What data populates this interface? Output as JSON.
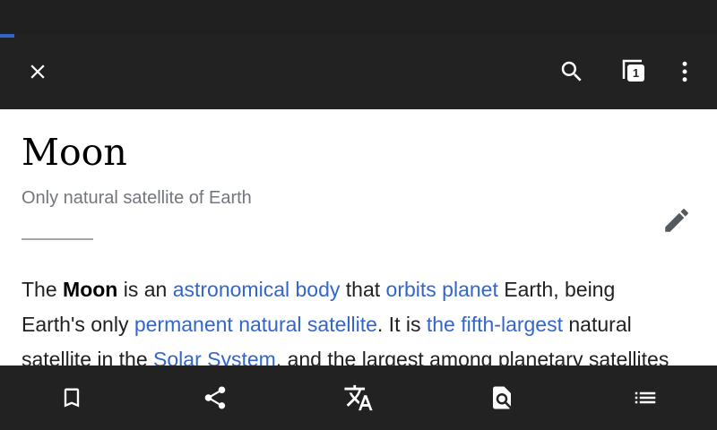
{
  "article": {
    "title": "Moon",
    "description": "Only natural satellite of Earth"
  },
  "toolbar": {
    "close_icon": "close-icon",
    "search_icon": "search-icon",
    "tabs_count": "1",
    "overflow_icon": "more-vert-icon"
  },
  "page_load_progress": 0.02,
  "paragraph": {
    "line1": [
      {
        "t": "The ",
        "kind": "text"
      },
      {
        "t": "Moon",
        "kind": "bold"
      },
      {
        "t": " is an ",
        "kind": "text"
      },
      {
        "t": "astronomical body",
        "kind": "link"
      },
      {
        "t": " that ",
        "kind": "text"
      },
      {
        "t": "orbits planet",
        "kind": "link"
      },
      {
        "t": " Earth, being",
        "kind": "text"
      }
    ],
    "line2": [
      {
        "t": "Earth's only ",
        "kind": "text"
      },
      {
        "t": "permanent natural satellite",
        "kind": "link"
      },
      {
        "t": ". It is ",
        "kind": "text"
      },
      {
        "t": "the fifth-largest",
        "kind": "link"
      },
      {
        "t": " natural",
        "kind": "text"
      }
    ],
    "line3": [
      {
        "t": "satellite in the ",
        "kind": "text"
      },
      {
        "t": "Solar System",
        "kind": "link"
      },
      {
        "t": ", and the largest among planetary satellites",
        "kind": "text"
      }
    ]
  },
  "bottom_bar": {
    "items": [
      "bookmark-icon",
      "share-icon",
      "translate-icon",
      "find-in-page-icon",
      "contents-list-icon"
    ]
  },
  "colors": {
    "toolbar_bg": "#222222",
    "link": "#3366cc",
    "progress": "#3366cc"
  }
}
